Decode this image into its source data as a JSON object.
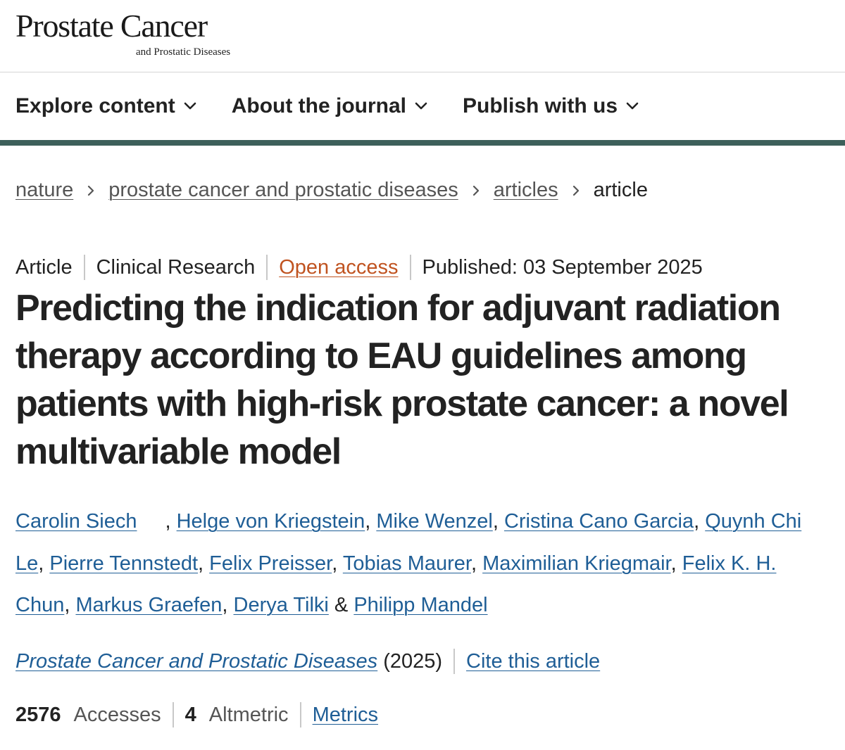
{
  "header": {
    "logo_title": "Prostate Cancer",
    "logo_subtitle": "and Prostatic Diseases"
  },
  "nav": {
    "items": [
      {
        "label": "Explore content",
        "icon": "chevron-down-icon"
      },
      {
        "label": "About the journal",
        "icon": "chevron-down-icon"
      },
      {
        "label": "Publish with us",
        "icon": "chevron-down-icon"
      }
    ],
    "accent_color": "#3d605a"
  },
  "breadcrumb": {
    "items": [
      {
        "label": "nature"
      },
      {
        "label": "prostate cancer and prostatic diseases"
      },
      {
        "label": "articles"
      },
      {
        "label": "article"
      }
    ],
    "separator_icon": "chevron-right-icon"
  },
  "article": {
    "type": "Article",
    "category": "Clinical Research",
    "access": "Open access",
    "access_color": "#c05320",
    "published": "Published: 03 September 2025",
    "title": "Predicting the indication for adjuvant radiation therapy according to EAU guidelines among patients with high-risk prostate cancer: a novel multivariable model",
    "authors": [
      "Carolin Siech",
      "Helge von Kriegstein",
      "Mike Wenzel",
      "Cristina Cano Garcia",
      "Quynh Chi Le",
      "Pierre Tennstedt",
      "Felix Preisser",
      "Tobias Maurer",
      "Maximilian Kriegmair",
      "Felix K. H. Chun",
      "Markus Graefen",
      "Derya Tilki",
      "Philipp Mandel"
    ],
    "author_separator": ", ",
    "author_last_separator": " & ",
    "link_color": "#1f5e96",
    "journal": "Prostate Cancer and Prostatic Diseases",
    "year": "(2025)",
    "cite_label": "Cite this article"
  },
  "metrics": {
    "accesses_count": "2576",
    "accesses_label": "Accesses",
    "altmetric_count": "4",
    "altmetric_label": "Altmetric",
    "metrics_link": "Metrics"
  }
}
